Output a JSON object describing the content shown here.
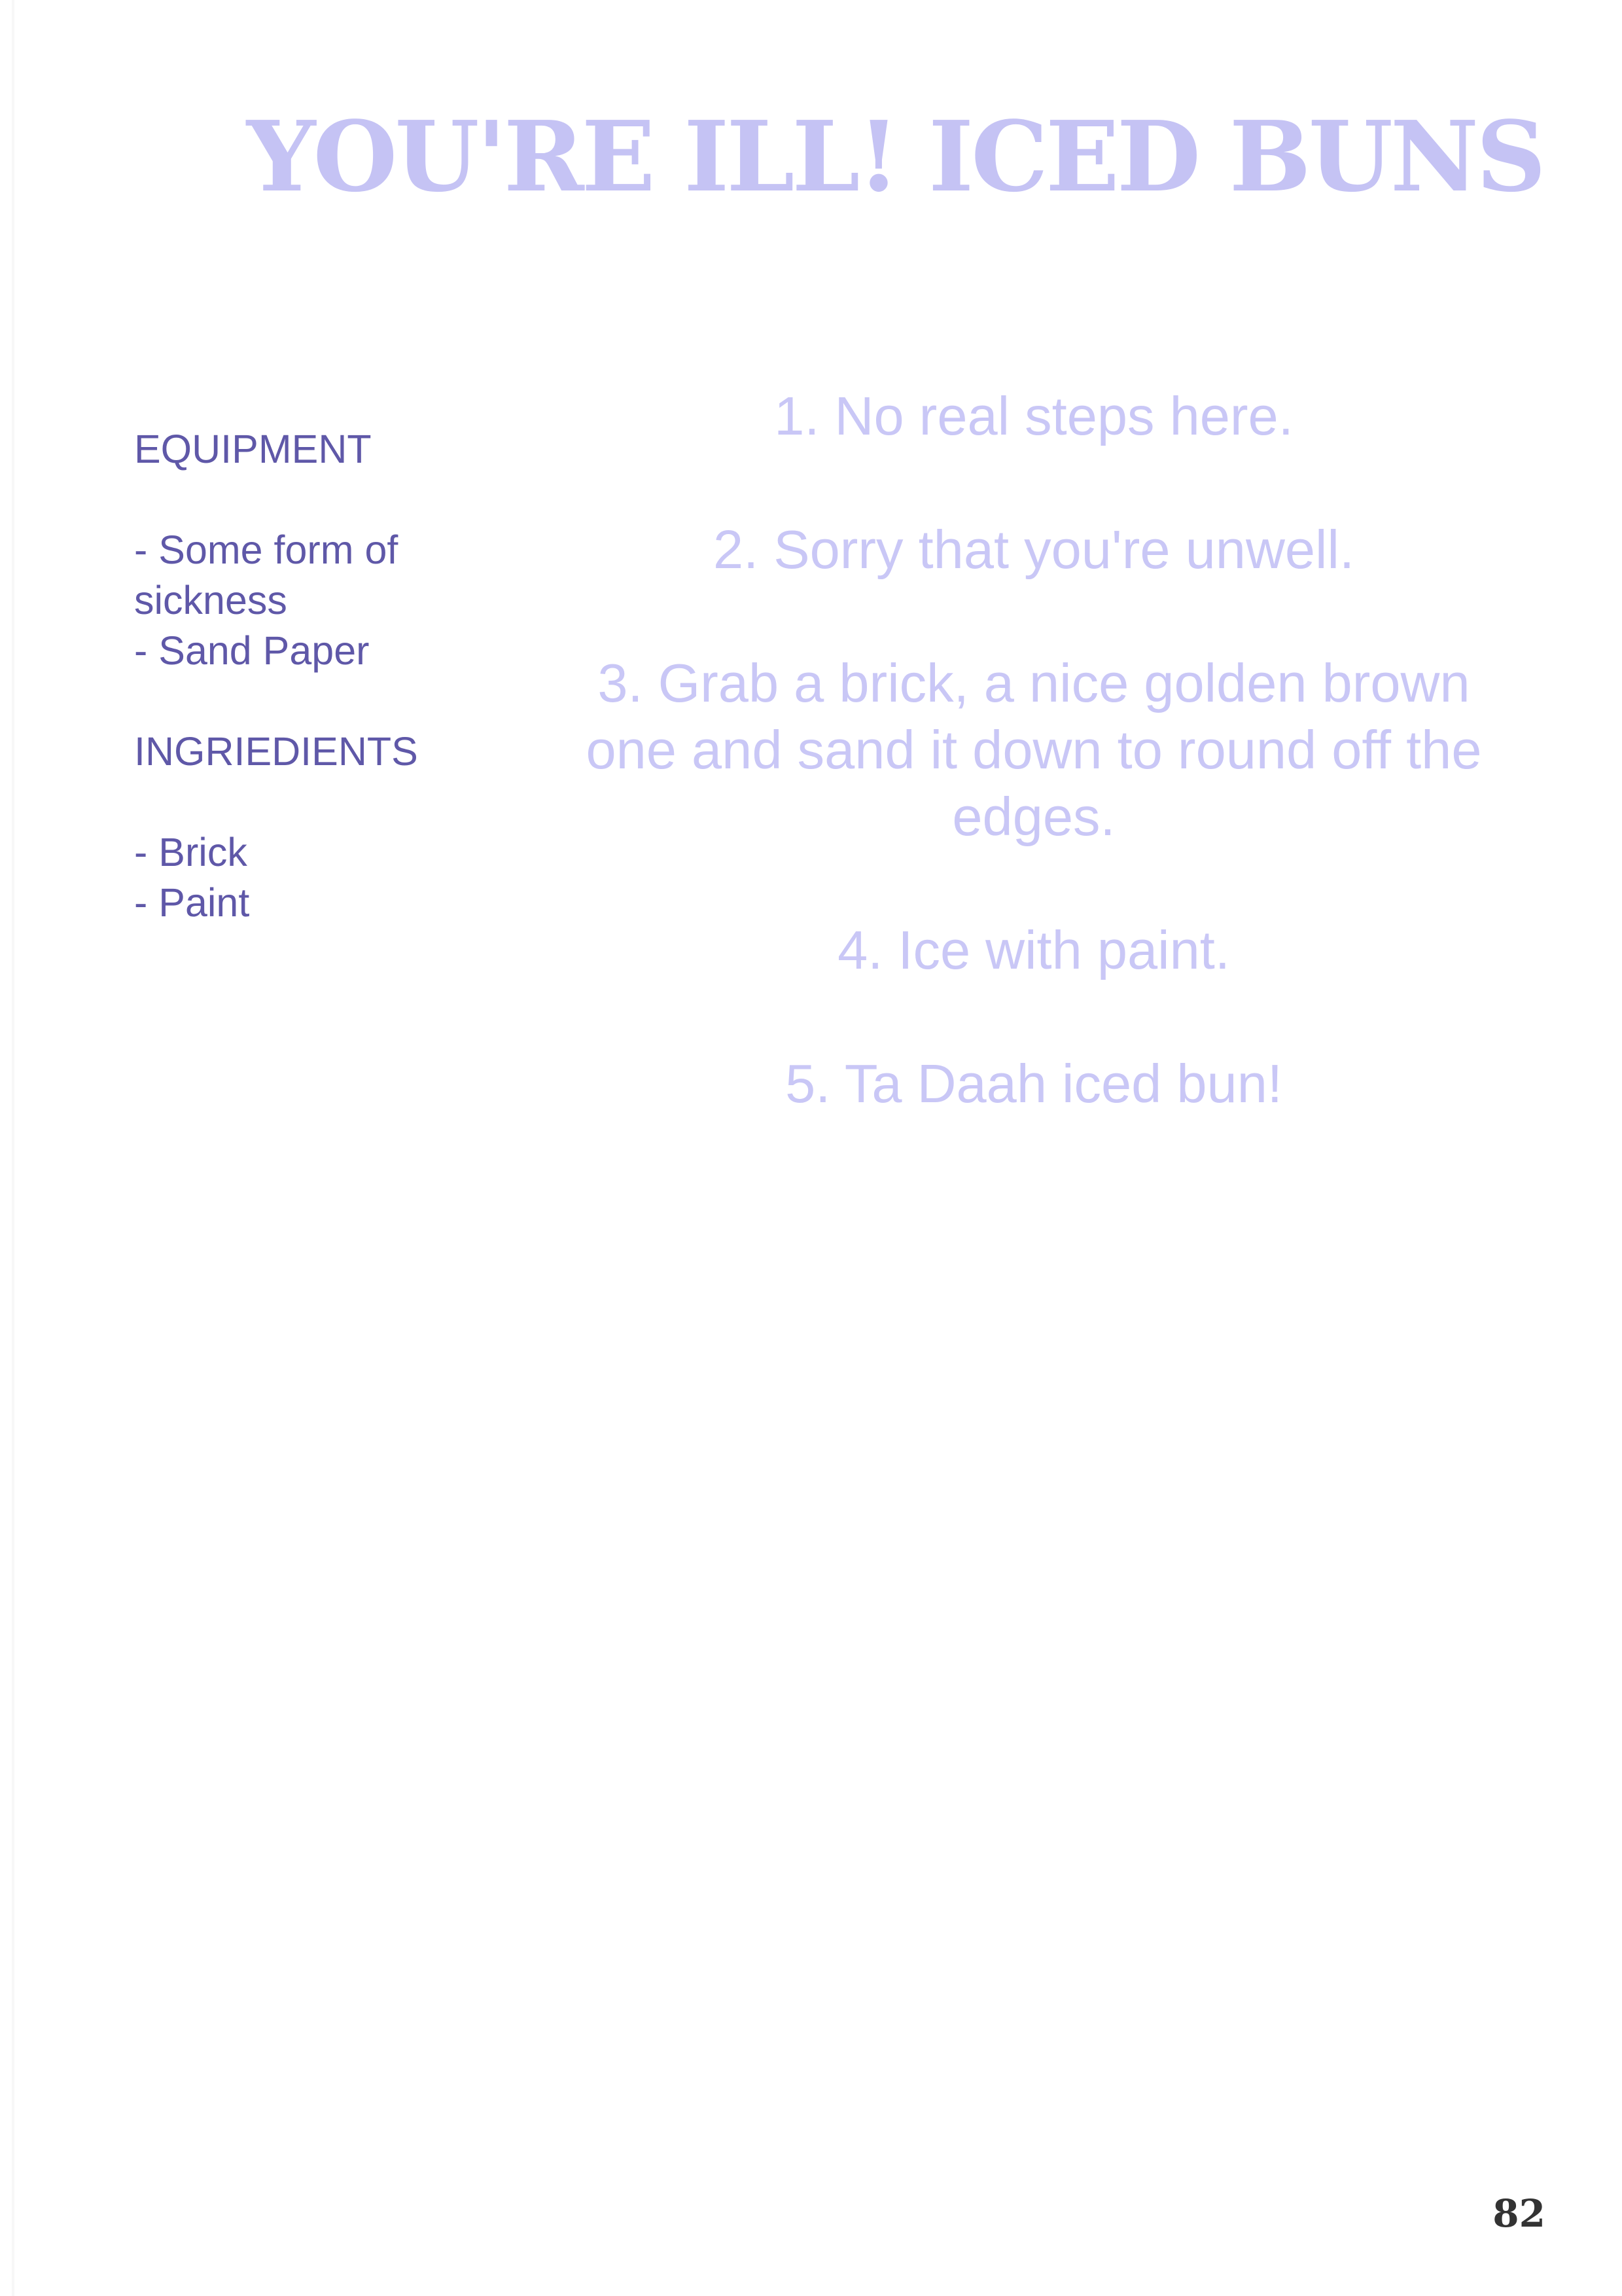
{
  "title": "YOU'RE ILL! ICED BUNS",
  "equipment": {
    "heading": "EQUIPMENT",
    "items": [
      "- Some form of sickness",
      "- Sand Paper"
    ]
  },
  "ingredients": {
    "heading": "INGRIEDIENTS",
    "items": [
      "- Brick",
      "- Paint"
    ]
  },
  "steps": [
    "1. No real steps here.",
    "2. Sorry that you're unwell.",
    "3. Grab a brick, a nice golden brown one and sand it down to round off the edges.",
    "4. Ice with paint.",
    "5. Ta Daah iced bun!"
  ],
  "page_number": "82",
  "colors": {
    "title": "#c5c3f4",
    "sidebar_text": "#5f58a8",
    "steps_text": "#c9c7f6",
    "page_number": "#333333"
  }
}
